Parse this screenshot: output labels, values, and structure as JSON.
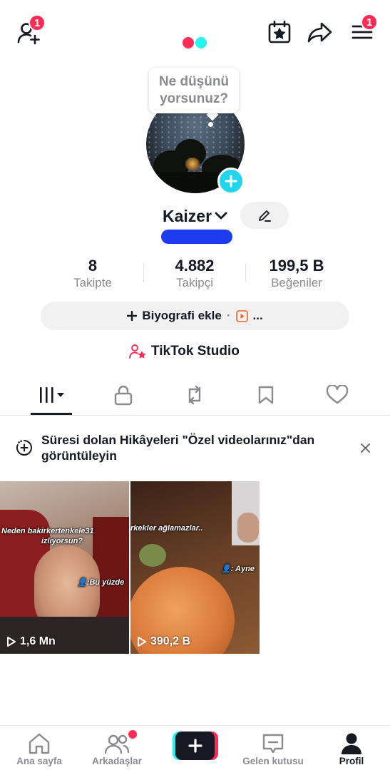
{
  "top_bar": {
    "add_friend_badge": "1",
    "menu_badge": "1",
    "logo_colors": {
      "red": "#fe2c55",
      "cyan": "#25f4ee"
    }
  },
  "profile": {
    "status_prompt_line1": "Ne düşünü",
    "status_prompt_line2": "yorsunuz?",
    "username": "Kaizer",
    "stats": [
      {
        "value": "8",
        "label": "Takipte"
      },
      {
        "value": "4.882",
        "label": "Takipçi"
      },
      {
        "value": "199,5 B",
        "label": "Beğeniler"
      }
    ],
    "bio_button": "Biyografi ekle",
    "bio_separator": "·",
    "bio_more": "...",
    "studio_label": "TikTok Studio"
  },
  "tabs": [
    "videos-tab",
    "private-tab",
    "reposts-tab",
    "favorites-tab",
    "liked-tab"
  ],
  "notice": {
    "text": "Süresi dolan Hikâyeleri \"Özel videolarınız\"dan görüntüleyin"
  },
  "videos": [
    {
      "caption_line1": "Neden bakirkertenkele31",
      "caption_line2": "izliyorsun?",
      "caption_tag": "👤:Bu yüzde",
      "views": "1,6 Mn"
    },
    {
      "caption_line1": "rkekler ağlamazlar..",
      "caption_tag": "👤: Ayne",
      "views": "390,2 B"
    }
  ],
  "bottom_nav": {
    "home": "Ana sayfa",
    "friends": "Arkadaşlar",
    "inbox": "Gelen kutusu",
    "profile": "Profil"
  },
  "colors": {
    "accent_red": "#fe2c55",
    "accent_cyan": "#20d5ec",
    "text_primary": "#161823",
    "text_secondary": "#8a8b91"
  }
}
